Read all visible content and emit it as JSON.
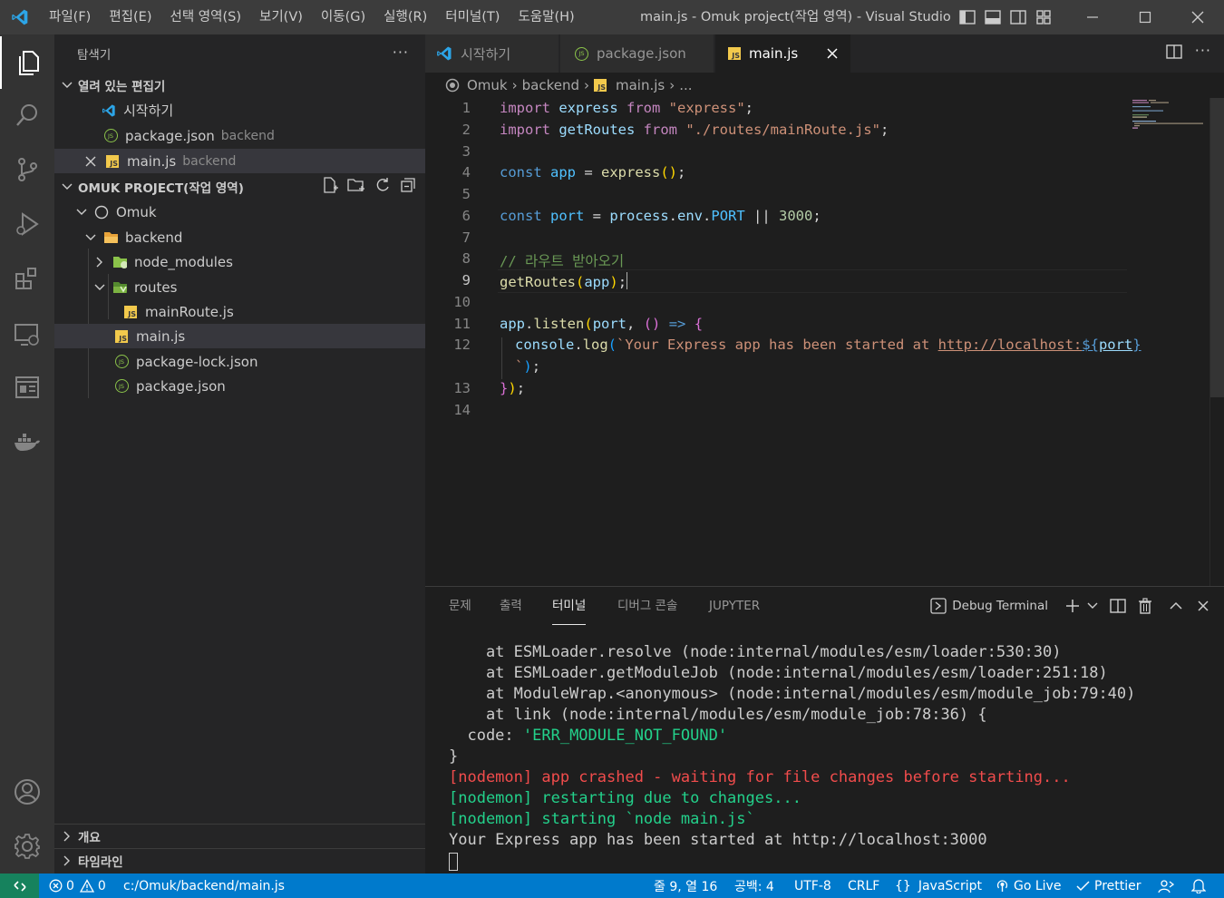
{
  "titlebar": {
    "menus": [
      "파일(F)",
      "편집(E)",
      "선택 영역(S)",
      "보기(V)",
      "이동(G)",
      "실행(R)",
      "터미널(T)",
      "도움말(H)"
    ],
    "window_title": "main.js - Omuk project(작업 영역) - Visual Studio ..."
  },
  "sidebar": {
    "title": "탐색기",
    "open_editors_header": "열려 있는 편집기",
    "open_editors": [
      {
        "name": "시작하기",
        "desc": ""
      },
      {
        "name": "package.json",
        "desc": "backend"
      },
      {
        "name": "main.js",
        "desc": "backend"
      }
    ],
    "project_header": "OMUK PROJECT(작업 영역)",
    "tree": [
      {
        "name": "Omuk"
      },
      {
        "name": "backend"
      },
      {
        "name": "node_modules"
      },
      {
        "name": "routes"
      },
      {
        "name": "mainRoute.js"
      },
      {
        "name": "main.js"
      },
      {
        "name": "package-lock.json"
      },
      {
        "name": "package.json"
      }
    ],
    "outline_header": "개요",
    "timeline_header": "타임라인"
  },
  "tabs": [
    {
      "label": "시작하기"
    },
    {
      "label": "package.json"
    },
    {
      "label": "main.js"
    }
  ],
  "breadcrumb": {
    "root": "Omuk",
    "folder": "backend",
    "file": "main.js",
    "rest": "..."
  },
  "editor": {
    "line_numbers": [
      "1",
      "2",
      "3",
      "4",
      "5",
      "6",
      "7",
      "8",
      "9",
      "10",
      "11",
      "12",
      "13",
      "14"
    ],
    "lines": [
      {
        "t1": "import",
        "t2": " express ",
        "t3": "from",
        "t4": " \"express\"",
        "t5": ";"
      },
      {
        "t1": "import",
        "t2": " getRoutes ",
        "t3": "from",
        "t4": " \"./routes/mainRoute.js\"",
        "t5": ";"
      },
      {
        "kw": "const",
        "v": " app ",
        "op": "= ",
        "fn": "express",
        "p": "()",
        "e": ";"
      },
      {
        "kw": "const",
        "v": " port ",
        "op": "= ",
        "o": "process",
        "d1": ".",
        "o2": "env",
        "d2": ".",
        "c": "PORT",
        "or": " || ",
        "n": "3000",
        "e": ";"
      },
      {
        "comment": "// 라우트 받아오기"
      },
      {
        "fn": "getRoutes",
        "p1": "(",
        "a": "app",
        "p2": ")",
        "e": ";"
      },
      {
        "o": "app",
        "d": ".",
        "fn": "listen",
        "p1": "(",
        "a": "port",
        "c": ", ",
        "p2": "()",
        "ar": " => ",
        "b": "{"
      },
      {
        "o": "console",
        "d": ".",
        "fn": "log",
        "p1": "(",
        "s": "`Your Express app has been started at ",
        "link": "http://localhost:",
        "tm": "${",
        "tv": "port",
        "te": "}"
      },
      {
        "s": "`",
        "p": ")",
        "e": ";"
      },
      {
        "b": "}",
        "p": ")",
        "e": ";"
      }
    ]
  },
  "panel": {
    "tabs": [
      "문제",
      "출력",
      "터미널",
      "디버그 콘솔",
      "JUPYTER"
    ],
    "debug_terminal": "Debug Terminal",
    "terminal_lines": [
      {
        "text": "    at ESMLoader.resolve (node:internal/modules/esm/loader:530:30)",
        "color": "gray"
      },
      {
        "text": "    at ESMLoader.getModuleJob (node:internal/modules/esm/loader:251:18)",
        "color": "gray"
      },
      {
        "text": "    at ModuleWrap.<anonymous> (node:internal/modules/esm/module_job:79:40)",
        "color": "gray"
      },
      {
        "text": "    at link (node:internal/modules/esm/module_job:78:36) {",
        "color": "gray"
      },
      {
        "text": "  code: ",
        "extra": "'ERR_MODULE_NOT_FOUND'",
        "color": "gray"
      },
      {
        "text": "}",
        "color": "gray"
      },
      {
        "text": "[nodemon] app crashed - waiting for file changes before starting...",
        "color": "red"
      },
      {
        "text": "[nodemon] restarting due to changes...",
        "color": "green"
      },
      {
        "text": "[nodemon] starting `node main.js`",
        "color": "green"
      },
      {
        "text": "Your Express app has been started at http://localhost:3000",
        "color": "gray"
      }
    ]
  },
  "statusbar": {
    "errors": "0",
    "warnings": "0",
    "path": "c:/Omuk/backend/main.js",
    "position": "줄 9, 열 16",
    "spaces": "공백: 4",
    "encoding": "UTF-8",
    "eol": "CRLF",
    "language": "JavaScript",
    "golive": "Go Live",
    "prettier": "Prettier"
  },
  "colors": {
    "accent": "#007acc",
    "remote": "#16825d",
    "js_icon": "#f2c94c",
    "json_icon": "#8bc34a",
    "terminal_green": "#23d18b",
    "terminal_red": "#f14c4c"
  }
}
